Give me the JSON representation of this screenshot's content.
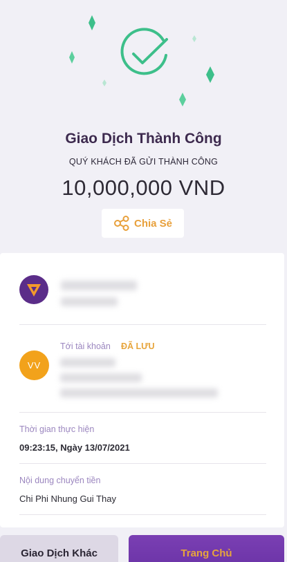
{
  "status": {
    "title": "Giao Dịch Thành Công",
    "subtitle": "QUÝ KHÁCH ĐÃ GỬI THÀNH CÔNG",
    "amount": "10,000,000 VND"
  },
  "share": {
    "label": "Chia Sẻ",
    "icon": "share-icon"
  },
  "recipient": {
    "to_label": "Tới tài khoản",
    "saved_badge": "ĐÃ LƯU",
    "avatar_initials": "VV"
  },
  "details": {
    "time_label": "Thời gian thực hiện",
    "time_value": "09:23:15, Ngày 13/07/2021",
    "content_label": "Nội dung chuyển tiền",
    "content_value": "Chi Phi Nhung Gui Thay"
  },
  "actions": {
    "other_label": "Giao Dịch Khác",
    "home_label": "Trang Chủ"
  },
  "colors": {
    "brand_purple": "#6a33a6",
    "accent_orange": "#e7a53c",
    "success_green": "#3dbf8a"
  }
}
